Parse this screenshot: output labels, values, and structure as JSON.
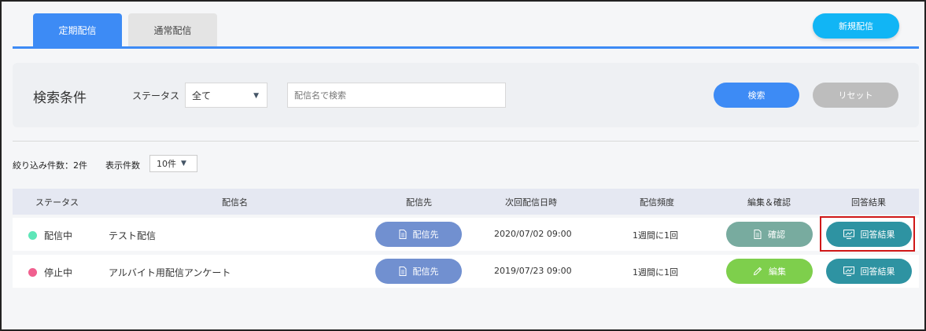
{
  "tabs": [
    {
      "label": "定期配信",
      "active": true
    },
    {
      "label": "通常配信",
      "active": false
    }
  ],
  "new_button": "新規配信",
  "search": {
    "title": "検索条件",
    "status_label": "ステータス",
    "status_value": "全て",
    "name_placeholder": "配信名で検索",
    "search_button": "検索",
    "reset_button": "リセット"
  },
  "filter": {
    "count_text": "絞り込み件数：2件",
    "per_page_label": "表示件数",
    "per_page_value": "10件"
  },
  "table": {
    "headers": [
      "ステータス",
      "配信名",
      "配信先",
      "次回配信日時",
      "配信頻度",
      "編集＆確認",
      "回答結果"
    ],
    "rows": [
      {
        "status": "配信中",
        "status_color": "#5ee6b8",
        "name": "テスト配信",
        "destination_button": "配信先",
        "next_datetime": "2020/07/02 09:00",
        "frequency": "1週間に1回",
        "action_button": "確認",
        "action_icon": "document-icon",
        "action_color": "#78ab9f",
        "result_button": "回答結果"
      },
      {
        "status": "停止中",
        "status_color": "#f0608f",
        "name": "アルバイト用配信アンケート",
        "destination_button": "配信先",
        "next_datetime": "2019/07/23 09:00",
        "frequency": "1週間に1回",
        "action_button": "編集",
        "action_icon": "pencil-icon",
        "action_color": "#7ecf4c",
        "result_button": "回答結果"
      }
    ]
  },
  "colors": {
    "primary": "#3d8bf5",
    "new_button": "#11b5f5",
    "destination_button": "#7190d0",
    "result_button": "#2e93a2",
    "highlight": "#d01818"
  }
}
